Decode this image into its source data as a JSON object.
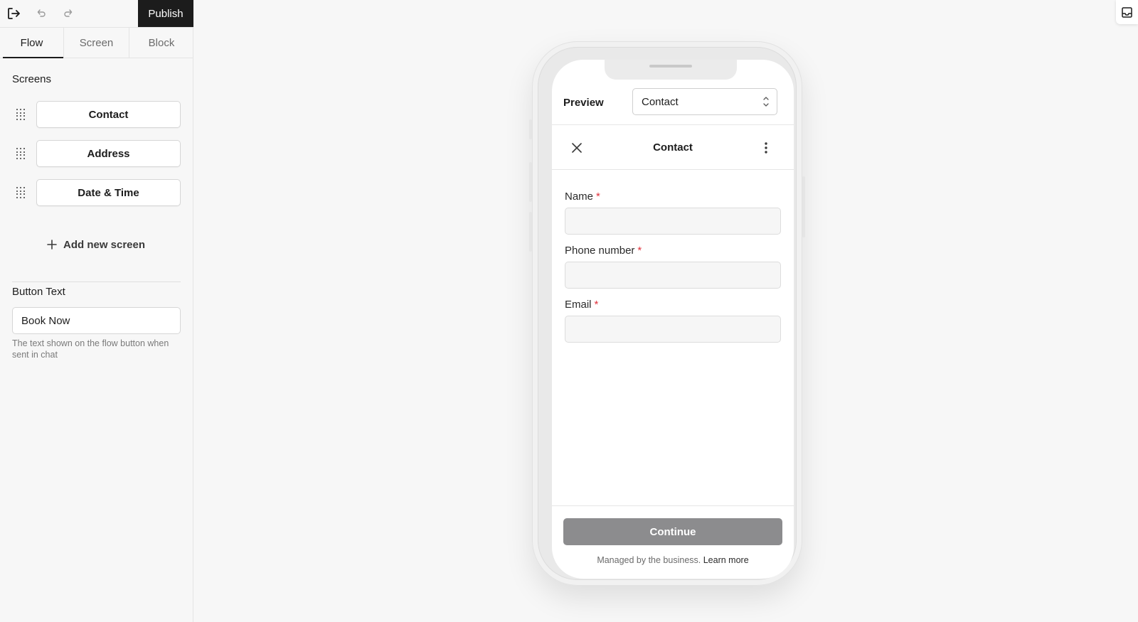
{
  "toolbar": {
    "exit_icon": "exit-icon",
    "undo_icon": "undo-icon",
    "redo_icon": "redo-icon",
    "publish_label": "Publish"
  },
  "tabs": [
    {
      "label": "Flow",
      "active": true
    },
    {
      "label": "Screen",
      "active": false
    },
    {
      "label": "Block",
      "active": false
    }
  ],
  "screens": {
    "title": "Screens",
    "items": [
      {
        "label": "Contact"
      },
      {
        "label": "Address"
      },
      {
        "label": "Date & Time"
      }
    ],
    "add_label": "Add new screen"
  },
  "button_text": {
    "label": "Button Text",
    "value": "Book Now",
    "helper": "The text shown on the flow button when sent in chat"
  },
  "preview": {
    "label": "Preview",
    "selected": "Contact"
  },
  "phone_screen": {
    "title": "Contact",
    "fields": [
      {
        "label": "Name",
        "required_mark": "*"
      },
      {
        "label": "Phone number",
        "required_mark": "*"
      },
      {
        "label": "Email",
        "required_mark": "*"
      }
    ],
    "continue_label": "Continue",
    "managed_text": "Managed by the business.",
    "learn_more": "Learn more"
  },
  "colors": {
    "dark": "#1c1c1c",
    "required": "#e0323c",
    "continue_disabled": "#8c8c8e",
    "background": "#f7f7f7"
  }
}
